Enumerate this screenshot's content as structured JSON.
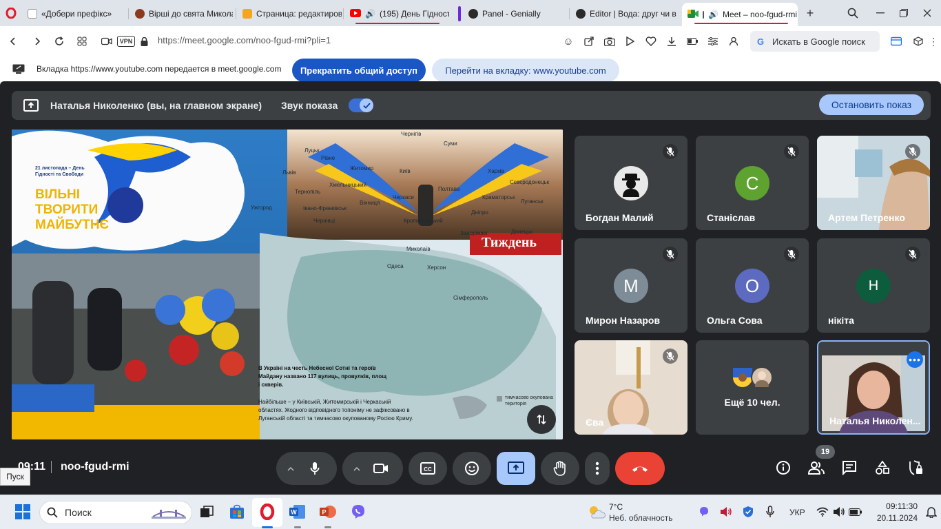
{
  "tabs": [
    {
      "label": "«Добери префікс»",
      "color": "#e2e2e2"
    },
    {
      "label": "Вірші до свята Микола",
      "color": "#8b3a1e"
    },
    {
      "label": "Страница: редактиров",
      "color": "#f4a522"
    },
    {
      "label": "(195) День Гідності",
      "color": "#ff0000"
    },
    {
      "label": "Panel - Genially",
      "color": "#2b2b2b"
    },
    {
      "label": "Editor | Вода: друг чи в",
      "color": "#2b2b2b"
    },
    {
      "label": "Meet – noo-fgud-rmi",
      "color": "#1e8e3e"
    }
  ],
  "address": {
    "url": "https://meet.google.com/noo-fgud-rmi?pli=1",
    "vpn": "VPN",
    "search_label": "Искать в Google поиск"
  },
  "share_bar": {
    "text": "Вкладка https://www.youtube.com передается в meet.google.com",
    "stop_sharing": "Прекратить общий доступ",
    "go_to_tab": "Перейти на вкладку: www.youtube.com"
  },
  "meet": {
    "presenter": "Наталья Николенко (вы, на главном экране)",
    "sound_label": "Звук показа",
    "stop_presentation": "Остановить показ",
    "time": "09:11",
    "meeting_code": "noo-fgud-rmi",
    "participants_count": "19",
    "participants": [
      {
        "name": "Богдан Малий",
        "initial": "",
        "color": "#2b2b2b",
        "kind": "anon"
      },
      {
        "name": "Станіслав",
        "initial": "С",
        "color": "#5ea32f",
        "kind": "letter"
      },
      {
        "name": "Артем Петренко",
        "initial": "",
        "color": "#9bb8c7",
        "kind": "video"
      },
      {
        "name": "Мирон Назаров",
        "initial": "М",
        "color": "#7e8c97",
        "kind": "letter"
      },
      {
        "name": "Ольга Сова",
        "initial": "О",
        "color": "#5c6bc0",
        "kind": "letter"
      },
      {
        "name": "нікіта",
        "initial": "Н",
        "color": "#0d5c3d",
        "kind": "letter"
      },
      {
        "name": "Єва",
        "initial": "",
        "color": "#d9c9b5",
        "kind": "video"
      },
      {
        "name": "Ещё 10 чел.",
        "initial": "",
        "color": "#3c4043",
        "kind": "more"
      },
      {
        "name": "Наталья Николен...",
        "initial": "",
        "color": "#c9c4bd",
        "kind": "self"
      }
    ],
    "slide": {
      "date_line": "21 листопада – День Гідності та Свободи",
      "slogan": [
        "ВІЛЬНІ",
        "ТВОРИТИ",
        "МАЙБУТНЄ"
      ],
      "magazine": "Тиждень",
      "caption": "В Україні на честь Небесної Сотні та героїв Майдану названо 117 вулиць, провулків, площ і скверів.",
      "note": "Найбільше – у Київській, Житомирській і Черкаській областях. Жодного відповідного топоніму не зафіксовано в Луганській області та тимчасово окупованому Росією Криму.",
      "legend": "тимчасово окупована територія",
      "cities": [
        "Луцьк",
        "Рівне",
        "Житомир",
        "Чернігів",
        "Суми",
        "Харків",
        "Київ",
        "Львів",
        "Тернопіль",
        "Хмельницький",
        "Івано-Франківськ",
        "Чернівці",
        "Ужгород",
        "Вінниця",
        "Черкаси",
        "Полтава",
        "Кропивницький",
        "Дніпро",
        "Краматорськ",
        "Сєвєродонецьк",
        "Луганськ",
        "Донецьк",
        "Запоріжжя",
        "Миколаїв",
        "Херсон",
        "Одеса",
        "Сімферополь"
      ]
    }
  },
  "tooltip": "Пуск",
  "taskbar": {
    "search": "Поиск",
    "weather_temp": "7°C",
    "weather_desc": "Неб. облачность",
    "lang": "УКР",
    "clock_time": "09:11:30",
    "clock_date": "20.11.2024"
  }
}
